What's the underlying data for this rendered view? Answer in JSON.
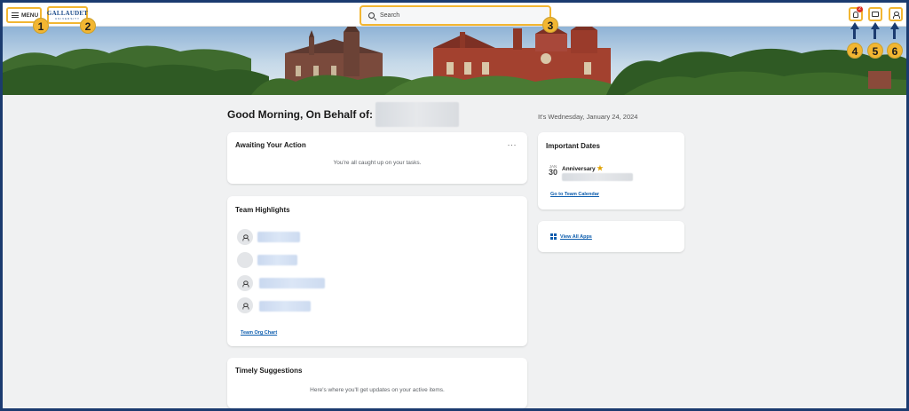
{
  "topbar": {
    "menu_label": "MENU",
    "logo_text": "GALLAUDET",
    "logo_sub": "UNIVERSITY",
    "search_placeholder": "Search",
    "notification_count": "2",
    "icons": [
      "menu-icon",
      "search-icon",
      "bell-icon",
      "inbox-icon",
      "profile-icon"
    ]
  },
  "callouts": [
    "1",
    "2",
    "3",
    "4",
    "5",
    "6"
  ],
  "main": {
    "greeting": "Good Morning, On Behalf of:",
    "date": "It's Wednesday, January 24, 2024"
  },
  "awaiting": {
    "title": "Awaiting Your Action",
    "more": "···",
    "message": "You're all caught up on your tasks."
  },
  "team": {
    "title": "Team Highlights",
    "link": "Team Org Chart"
  },
  "suggestions": {
    "title": "Timely Suggestions",
    "message": "Here's where you'll get updates on your active items."
  },
  "dates": {
    "title": "Important Dates",
    "month": "JAN",
    "day": "30",
    "event": "Anniversary",
    "link": "Go to Team Calendar"
  },
  "apps": {
    "link": "View All Apps"
  },
  "colors": {
    "accent": "#f2b632",
    "frame": "#1b3b6f",
    "link": "#0b5cad",
    "badge": "#de2e21"
  }
}
